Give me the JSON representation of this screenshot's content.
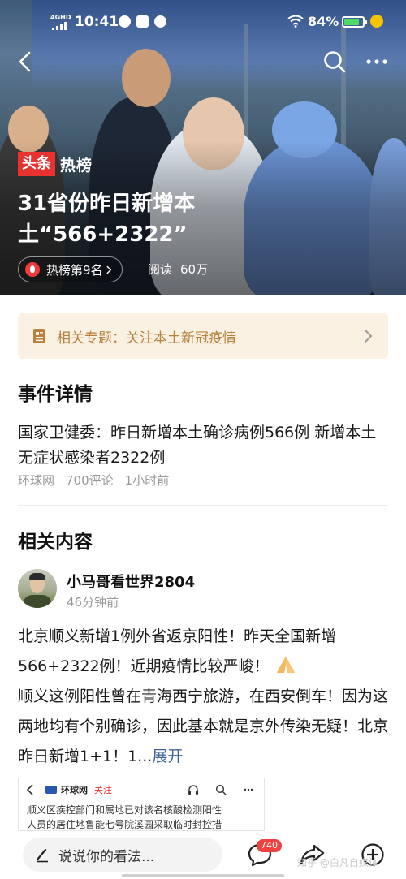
{
  "status_bar": {
    "network": "4GHD",
    "time": "10:41",
    "battery": "84%",
    "battery_level": 0.84
  },
  "hero": {
    "brand_tag": "头条",
    "brand_label": "热榜",
    "title": "31省份昨日新增本土“566+2322”",
    "rank": "热榜第9名",
    "read_label": "阅读",
    "read_count": "60万"
  },
  "topic": {
    "label": "相关专题：关注本土新冠疫情"
  },
  "event": {
    "section_title": "事件详情",
    "text": "国家卫健委：昨日新增本土确诊病例566例 新增本土无症状感染者2322例",
    "source": "环球网",
    "comments": "700评论",
    "time": "1小时前"
  },
  "related": {
    "section_title": "相关内容",
    "author": "小马哥看世界2804",
    "time": "46分钟前",
    "line1": "北京顺义新增1例外省返京阳性！昨天全国新增566+2322例！近期疫情比较严峻！",
    "line2": "顺义这例阳性曾在青海西宁旅游，在西安倒车！因为这两地均有个别确诊，因此基本就是京外传染无疑！北京昨日新增1+1！1...",
    "expand": "展开",
    "embed": {
      "source": "环球网",
      "follow": "关注",
      "line1": "顺义区疾控部门和属地已对该名核酸检测阳性",
      "line2": "人员的居住地鲁能七号院溪园采取临时封控措"
    }
  },
  "bottom_bar": {
    "comment_placeholder": "说说你的看法...",
    "comment_count": "740",
    "watermark": "知乎 @白凡自媒体"
  },
  "colors": {
    "brand_red": "#e8322f",
    "topic_bg": "#faf1e3",
    "topic_text": "#b7803d",
    "link_blue": "#406599"
  },
  "icons": [
    "back-icon",
    "search-icon",
    "more-icon",
    "flame-icon",
    "topic-doc-icon",
    "chevron-right-icon",
    "pen-icon",
    "comment-icon",
    "share-icon",
    "add-icon",
    "pray-emoji-icon"
  ]
}
